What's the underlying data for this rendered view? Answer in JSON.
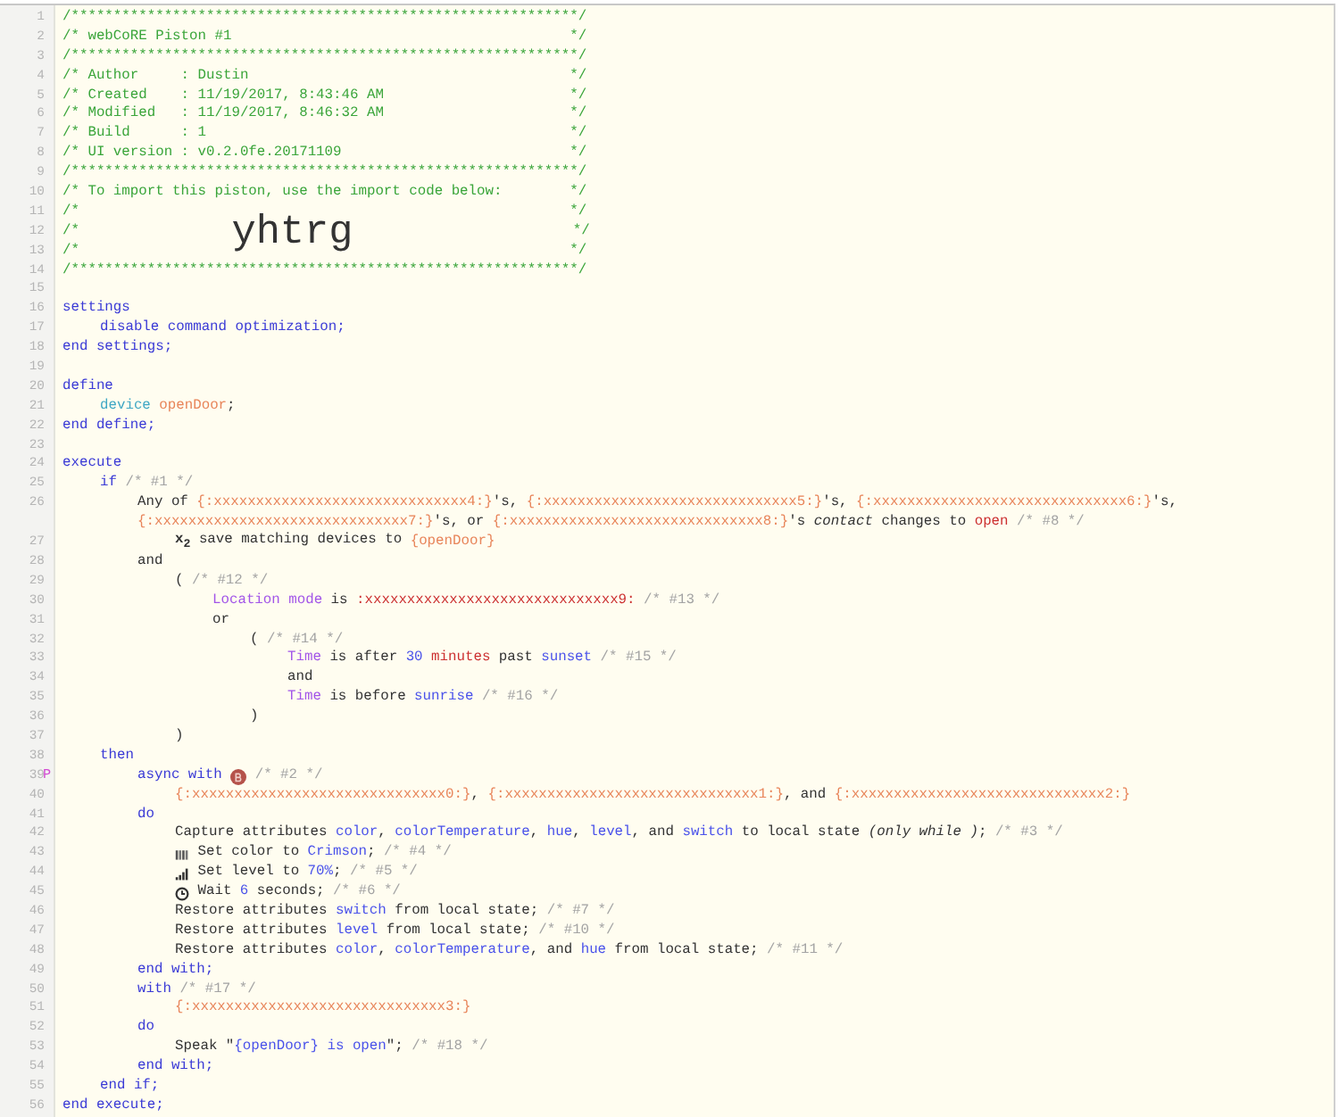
{
  "lines": [
    {
      "number": "1",
      "tokens": [
        {
          "text": "/************************************************************/",
          "kind": "comment"
        }
      ]
    },
    {
      "number": "2",
      "tokens": [
        {
          "text": "/* webCoRE Piston #1                                        */",
          "kind": "comment"
        }
      ]
    },
    {
      "number": "3",
      "tokens": [
        {
          "text": "/************************************************************/",
          "kind": "comment"
        }
      ]
    },
    {
      "number": "4",
      "tokens": [
        {
          "text": "/* Author     : Dustin                                      */",
          "kind": "comment"
        }
      ]
    },
    {
      "number": "5",
      "tokens": [
        {
          "text": "/* Created    : 11/19/2017, 8:43:46 AM                      */",
          "kind": "comment"
        }
      ]
    },
    {
      "number": "6",
      "tokens": [
        {
          "text": "/* Modified   : 11/19/2017, 8:46:32 AM                      */",
          "kind": "comment"
        }
      ]
    },
    {
      "number": "7",
      "tokens": [
        {
          "text": "/* Build      : 1                                           */",
          "kind": "comment"
        }
      ]
    },
    {
      "number": "8",
      "tokens": [
        {
          "text": "/* UI version : v0.2.0fe.20171109                           */",
          "kind": "comment"
        }
      ]
    },
    {
      "number": "9",
      "tokens": [
        {
          "text": "/************************************************************/",
          "kind": "comment"
        }
      ]
    },
    {
      "number": "10",
      "tokens": [
        {
          "text": "/* To import this piston, use the import code below:        */",
          "kind": "comment"
        }
      ]
    },
    {
      "number": "11",
      "tokens": [
        {
          "text": "/*                                                          */",
          "kind": "comment"
        }
      ]
    },
    {
      "number": "12",
      "tokens": [
        {
          "text": "/*                  ",
          "kind": "comment"
        },
        {
          "text": "yhtrg",
          "kind": "big"
        },
        {
          "text": "                          */",
          "kind": "comment"
        }
      ]
    },
    {
      "number": "13",
      "tokens": [
        {
          "text": "/*                                                          */",
          "kind": "comment"
        }
      ]
    },
    {
      "number": "14",
      "tokens": [
        {
          "text": "/************************************************************/",
          "kind": "comment"
        }
      ]
    },
    {
      "number": "15"
    },
    {
      "number": "16",
      "tokens": [
        {
          "text": "settings",
          "kind": "keyword"
        }
      ],
      "children": [
        {
          "number": "17",
          "tokens": [
            {
              "text": "disable command optimization;",
              "kind": "keyword"
            }
          ]
        }
      ]
    },
    {
      "number": "18",
      "tokens": [
        {
          "text": "end settings;",
          "kind": "keyword"
        }
      ]
    },
    {
      "number": "19"
    },
    {
      "number": "20",
      "tokens": [
        {
          "text": "define",
          "kind": "keyword"
        }
      ],
      "children": [
        {
          "number": "21",
          "tokens": [
            {
              "text": "device ",
              "kind": "type"
            },
            {
              "text": "openDoor",
              "kind": "device"
            },
            {
              "text": ";",
              "kind": "plain"
            }
          ]
        }
      ]
    },
    {
      "number": "22",
      "tokens": [
        {
          "text": "end define;",
          "kind": "keyword"
        }
      ]
    },
    {
      "number": "23"
    },
    {
      "number": "24",
      "tokens": [
        {
          "text": "execute",
          "kind": "keyword"
        }
      ],
      "children": [
        {
          "number": "25",
          "tokens": [
            {
              "text": "if",
              "kind": "keyword"
            },
            {
              "text": " /* #1 */",
              "kind": "note"
            }
          ],
          "children": [
            {
              "number": "26",
              "tokens": [
                {
                  "text": "Any of ",
                  "kind": "plain"
                },
                {
                  "text": "{:xxxxxxxxxxxxxxxxxxxxxxxxxxxxxx4:}",
                  "kind": "device"
                },
                {
                  "text": "'s, ",
                  "kind": "plain"
                },
                {
                  "text": "{:xxxxxxxxxxxxxxxxxxxxxxxxxxxxxx5:}",
                  "kind": "device"
                },
                {
                  "text": "'s, ",
                  "kind": "plain"
                },
                {
                  "text": "{:xxxxxxxxxxxxxxxxxxxxxxxxxxxxxx6:}",
                  "kind": "device"
                },
                {
                  "text": "'s,",
                  "kind": "plain"
                }
              ]
            },
            {
              "tokens": [
                {
                  "text": "{:xxxxxxxxxxxxxxxxxxxxxxxxxxxxxx7:}",
                  "kind": "device"
                },
                {
                  "text": "'s, or ",
                  "kind": "plain"
                },
                {
                  "text": "{:xxxxxxxxxxxxxxxxxxxxxxxxxxxxxx8:}",
                  "kind": "device"
                },
                {
                  "text": "'s ",
                  "kind": "plain"
                },
                {
                  "text": "contact",
                  "kind": "italic"
                },
                {
                  "text": " changes to ",
                  "kind": "plain"
                },
                {
                  "text": "open",
                  "kind": "literal"
                },
                {
                  "text": " /* #8 */",
                  "kind": "note"
                }
              ],
              "children": [
                {
                  "number": "27",
                  "tokens": [
                    {
                      "text": "**x$_{2}$** save matching devices to ",
                      "kind": "plain"
                    },
                    {
                      "text": "{openDoor}",
                      "kind": "device"
                    }
                  ]
                }
              ]
            },
            {
              "number": "28",
              "tokens": [
                {
                  "text": "and",
                  "kind": "plain"
                }
              ],
              "children": [
                {
                  "number": "29",
                  "tokens": [
                    {
                      "text": "(",
                      "kind": "plain"
                    },
                    {
                      "text": " /* #12 */",
                      "kind": "note"
                    }
                  ],
                  "children": [
                    {
                      "number": "30",
                      "tokens": [
                        {
                          "text": "Location mode",
                          "kind": "subject"
                        },
                        {
                          "text": " is ",
                          "kind": "plain"
                        },
                        {
                          "text": ":xxxxxxxxxxxxxxxxxxxxxxxxxxxxxx9:",
                          "kind": "literal"
                        },
                        {
                          "text": " /* #13 */",
                          "kind": "note"
                        }
                      ]
                    },
                    {
                      "number": "31",
                      "tokens": [
                        {
                          "text": "or",
                          "kind": "plain"
                        }
                      ],
                      "children": [
                        {
                          "number": "32",
                          "tokens": [
                            {
                              "text": "(",
                              "kind": "plain"
                            },
                            {
                              "text": " /* #14 */",
                              "kind": "note"
                            }
                          ],
                          "children": [
                            {
                              "number": "33",
                              "tokens": [
                                {
                                  "text": "Time",
                                  "kind": "subject"
                                },
                                {
                                  "text": " is after ",
                                  "kind": "plain"
                                },
                                {
                                  "text": "30",
                                  "kind": "value"
                                },
                                {
                                  "text": " minutes",
                                  "kind": "literal"
                                },
                                {
                                  "text": " past ",
                                  "kind": "plain"
                                },
                                {
                                  "text": "sunset",
                                  "kind": "value"
                                },
                                {
                                  "text": " /* #15 */",
                                  "kind": "note"
                                }
                              ]
                            },
                            {
                              "number": "34",
                              "tokens": [
                                {
                                  "text": "and",
                                  "kind": "plain"
                                }
                              ]
                            },
                            {
                              "number": "35",
                              "tokens": [
                                {
                                  "text": "Time",
                                  "kind": "subject"
                                },
                                {
                                  "text": " is before ",
                                  "kind": "plain"
                                },
                                {
                                  "text": "sunrise",
                                  "kind": "value"
                                },
                                {
                                  "text": " /* #16 */",
                                  "kind": "note"
                                }
                              ]
                            }
                          ]
                        },
                        {
                          "number": "36",
                          "tokens": [
                            {
                              "text": ")",
                              "kind": "plain"
                            }
                          ]
                        }
                      ]
                    }
                  ]
                },
                {
                  "number": "37",
                  "tokens": [
                    {
                      "text": ")",
                      "kind": "plain"
                    }
                  ]
                }
              ]
            }
          ]
        },
        {
          "number": "38",
          "tokens": [
            {
              "text": "then",
              "kind": "keyword"
            }
          ],
          "children": [
            {
              "number": "39",
              "marker": "P",
              "tokens": [
                {
                  "text": "async with ",
                  "kind": "keyword"
                },
                {
                  "kind": "badge"
                },
                {
                  "text": " /* #2 */",
                  "kind": "note"
                }
              ],
              "children": [
                {
                  "number": "40",
                  "tokens": [
                    {
                      "text": "{:xxxxxxxxxxxxxxxxxxxxxxxxxxxxxx0:}",
                      "kind": "device"
                    },
                    {
                      "text": ", ",
                      "kind": "plain"
                    },
                    {
                      "text": "{:xxxxxxxxxxxxxxxxxxxxxxxxxxxxxx1:}",
                      "kind": "device"
                    },
                    {
                      "text": ", and ",
                      "kind": "plain"
                    },
                    {
                      "text": "{:xxxxxxxxxxxxxxxxxxxxxxxxxxxxxx2:}",
                      "kind": "device"
                    }
                  ]
                }
              ]
            },
            {
              "number": "41",
              "tokens": [
                {
                  "text": "do",
                  "kind": "keyword"
                }
              ],
              "children": [
                {
                  "number": "42",
                  "tokens": [
                    {
                      "text": "Capture attributes ",
                      "kind": "plain"
                    },
                    {
                      "text": "color",
                      "kind": "value"
                    },
                    {
                      "text": ", ",
                      "kind": "plain"
                    },
                    {
                      "text": "colorTemperature",
                      "kind": "value"
                    },
                    {
                      "text": ", ",
                      "kind": "plain"
                    },
                    {
                      "text": "hue",
                      "kind": "value"
                    },
                    {
                      "text": ", ",
                      "kind": "plain"
                    },
                    {
                      "text": "level",
                      "kind": "value"
                    },
                    {
                      "text": ", and ",
                      "kind": "plain"
                    },
                    {
                      "text": "switch",
                      "kind": "value"
                    },
                    {
                      "text": " to local state ",
                      "kind": "plain"
                    },
                    {
                      "text": "(only while )",
                      "kind": "italic"
                    },
                    {
                      "text": "; ",
                      "kind": "plain"
                    },
                    {
                      "text": "/* #3 */",
                      "kind": "note"
                    }
                  ]
                },
                {
                  "number": "43",
                  "tokens": [
                    {
                      "kind": "swatch"
                    },
                    {
                      "text": " Set color to ",
                      "kind": "plain"
                    },
                    {
                      "text": "Crimson",
                      "kind": "value"
                    },
                    {
                      "text": "; ",
                      "kind": "plain"
                    },
                    {
                      "text": "/* #4 */",
                      "kind": "note"
                    }
                  ]
                },
                {
                  "number": "44",
                  "tokens": [
                    {
                      "kind": "bars"
                    },
                    {
                      "text": " Set level to ",
                      "kind": "plain"
                    },
                    {
                      "text": "70%",
                      "kind": "value"
                    },
                    {
                      "text": "; ",
                      "kind": "plain"
                    },
                    {
                      "text": "/* #5 */",
                      "kind": "note"
                    }
                  ]
                },
                {
                  "number": "45",
                  "tokens": [
                    {
                      "kind": "clock"
                    },
                    {
                      "text": " Wait ",
                      "kind": "plain"
                    },
                    {
                      "text": "6",
                      "kind": "value"
                    },
                    {
                      "text": " seconds; ",
                      "kind": "plain"
                    },
                    {
                      "text": "/* #6 */",
                      "kind": "note"
                    }
                  ]
                },
                {
                  "number": "46",
                  "tokens": [
                    {
                      "text": "Restore attributes ",
                      "kind": "plain"
                    },
                    {
                      "text": "switch",
                      "kind": "value"
                    },
                    {
                      "text": " from local state; ",
                      "kind": "plain"
                    },
                    {
                      "text": "/* #7 */",
                      "kind": "note"
                    }
                  ]
                },
                {
                  "number": "47",
                  "tokens": [
                    {
                      "text": "Restore attributes ",
                      "kind": "plain"
                    },
                    {
                      "text": "level",
                      "kind": "value"
                    },
                    {
                      "text": " from local state; ",
                      "kind": "plain"
                    },
                    {
                      "text": "/* #10 */",
                      "kind": "note"
                    }
                  ]
                },
                {
                  "number": "48",
                  "tokens": [
                    {
                      "text": "Restore attributes ",
                      "kind": "plain"
                    },
                    {
                      "text": "color",
                      "kind": "value"
                    },
                    {
                      "text": ", ",
                      "kind": "plain"
                    },
                    {
                      "text": "colorTemperature",
                      "kind": "value"
                    },
                    {
                      "text": ", and ",
                      "kind": "plain"
                    },
                    {
                      "text": "hue",
                      "kind": "value"
                    },
                    {
                      "text": " from local state; ",
                      "kind": "plain"
                    },
                    {
                      "text": "/* #11 */",
                      "kind": "note"
                    }
                  ]
                }
              ]
            },
            {
              "number": "49",
              "tokens": [
                {
                  "text": "end with;",
                  "kind": "keyword"
                }
              ]
            },
            {
              "number": "50",
              "tokens": [
                {
                  "text": "with",
                  "kind": "keyword"
                },
                {
                  "text": " /* #17 */",
                  "kind": "note"
                }
              ],
              "children": [
                {
                  "number": "51",
                  "tokens": [
                    {
                      "text": "{:xxxxxxxxxxxxxxxxxxxxxxxxxxxxxx3:}",
                      "kind": "device"
                    }
                  ]
                }
              ]
            },
            {
              "number": "52",
              "tokens": [
                {
                  "text": "do",
                  "kind": "keyword"
                }
              ],
              "children": [
                {
                  "number": "53",
                  "tokens": [
                    {
                      "text": "Speak \"",
                      "kind": "plain"
                    },
                    {
                      "text": "{openDoor} is open",
                      "kind": "value"
                    },
                    {
                      "text": "\"; ",
                      "kind": "plain"
                    },
                    {
                      "text": "/* #18 */",
                      "kind": "note"
                    }
                  ]
                }
              ]
            },
            {
              "number": "54",
              "tokens": [
                {
                  "text": "end with;",
                  "kind": "keyword"
                }
              ]
            }
          ]
        },
        {
          "number": "55",
          "tokens": [
            {
              "text": "end if;",
              "kind": "keyword"
            }
          ]
        }
      ]
    },
    {
      "number": "56",
      "tokens": [
        {
          "text": "end execute;",
          "kind": "keyword"
        }
      ]
    }
  ]
}
